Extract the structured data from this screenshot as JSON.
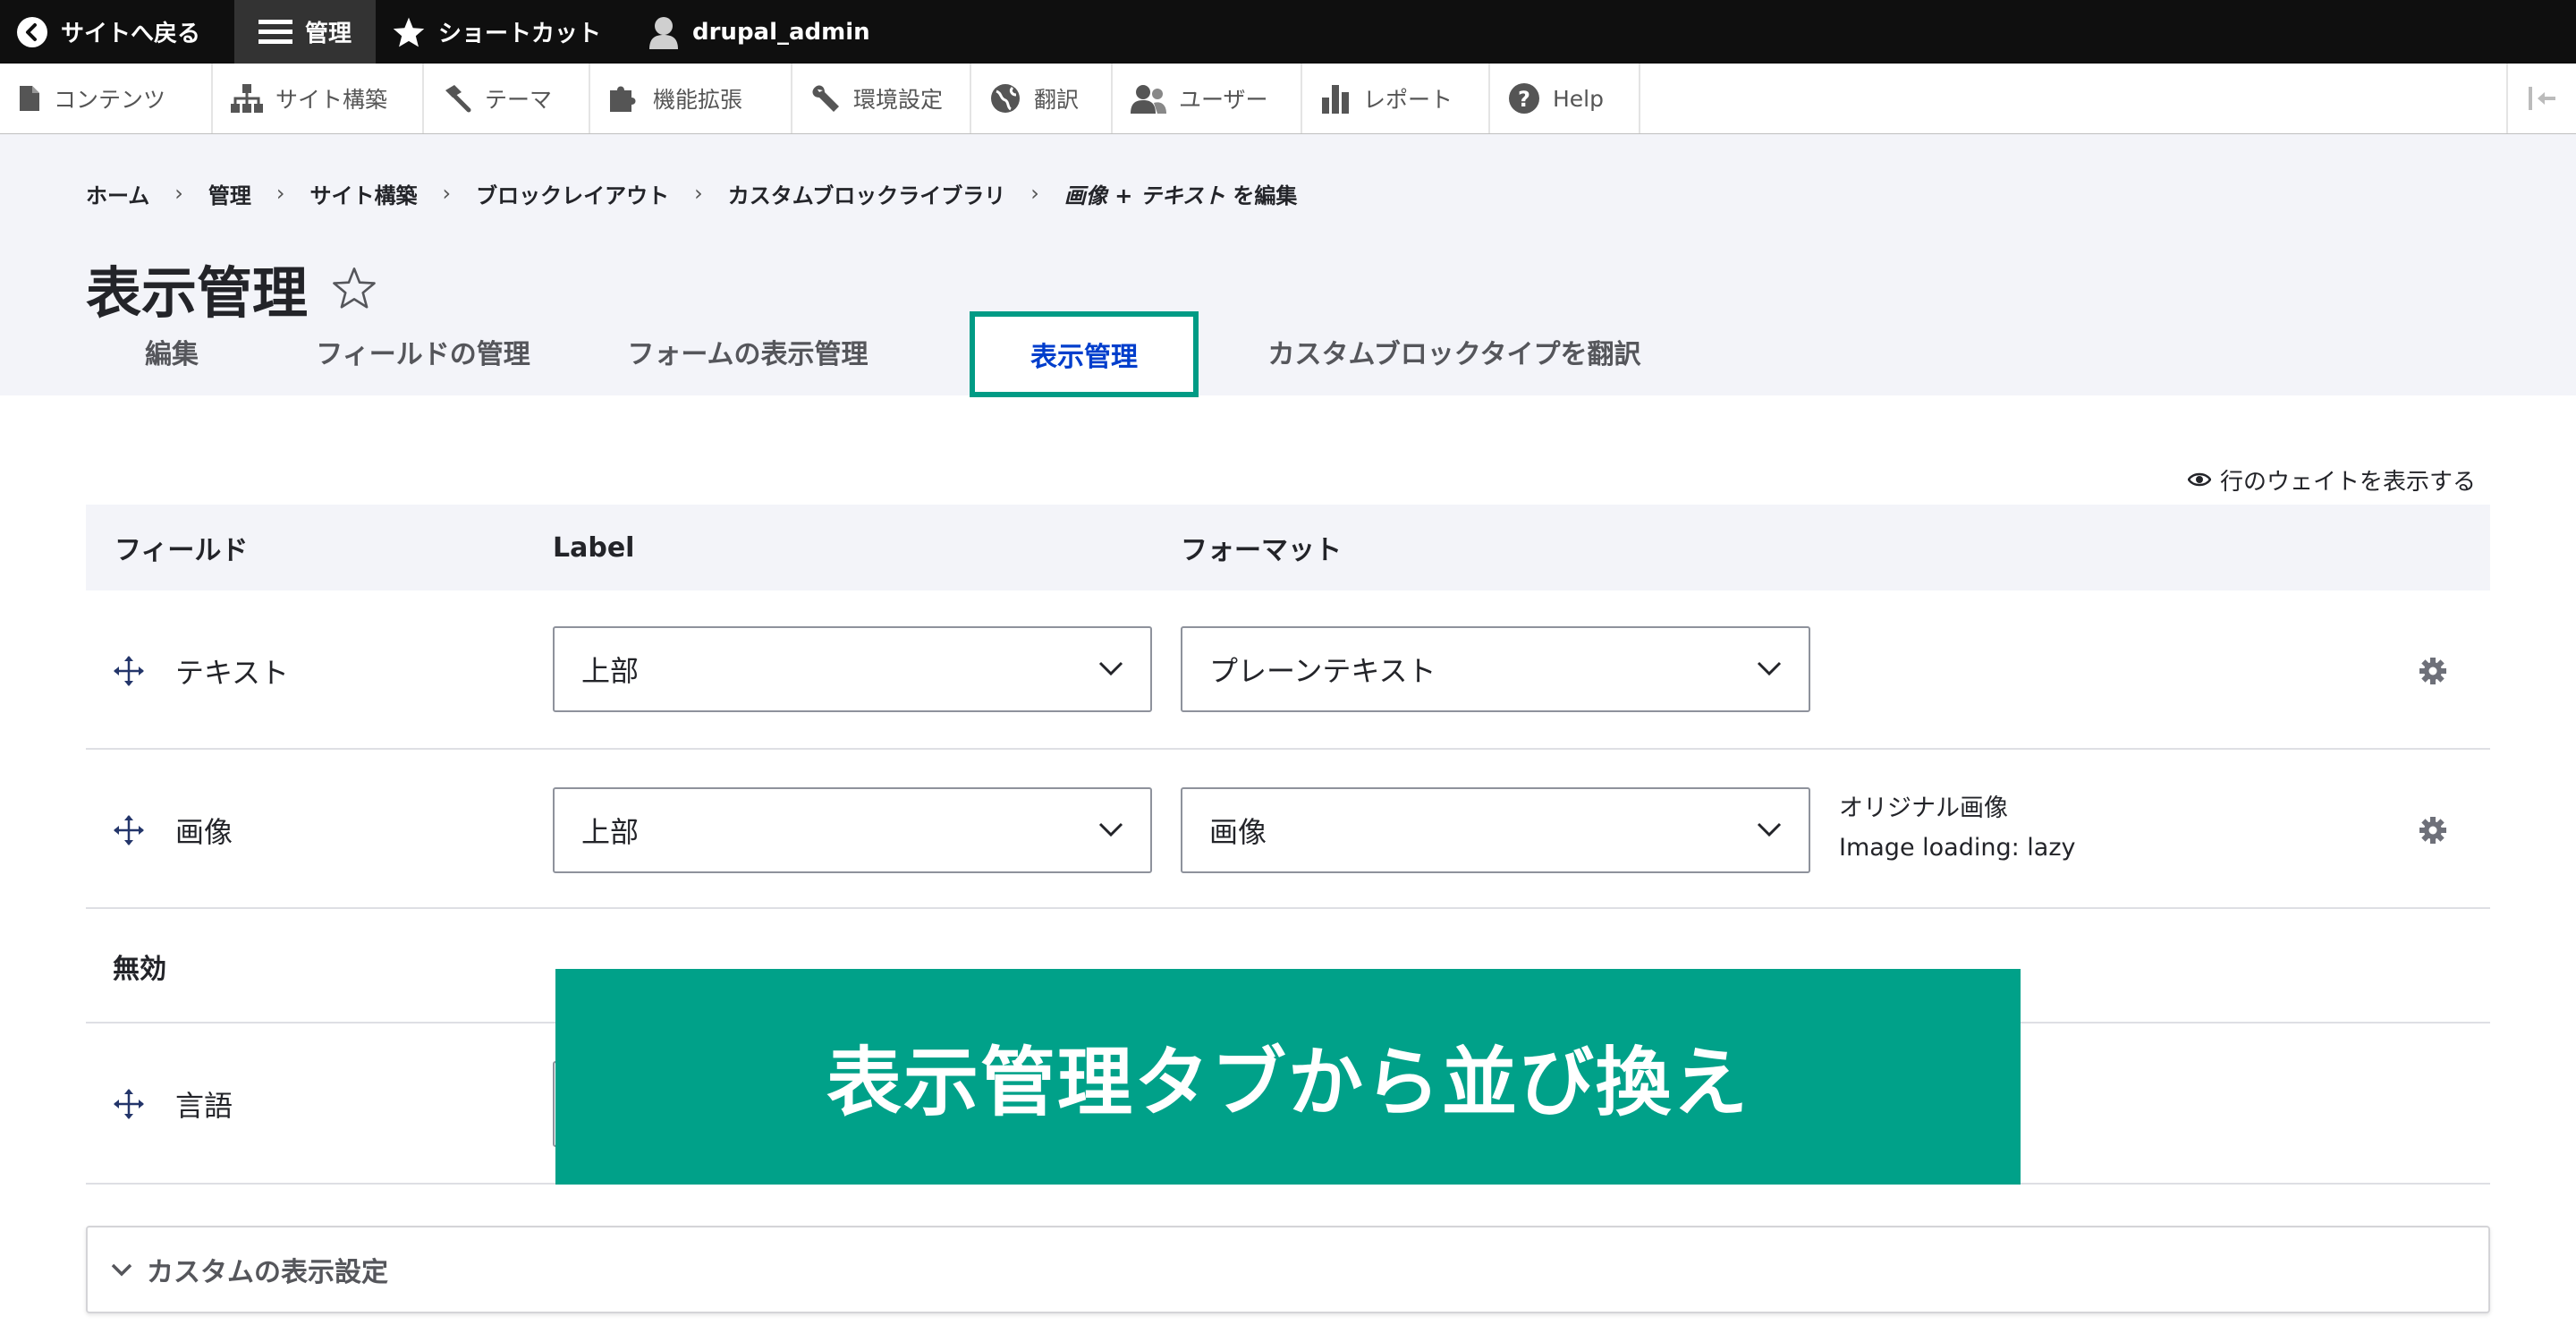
{
  "toolbar": {
    "back_label": "サイトへ戻る",
    "manage_label": "管理",
    "shortcuts_label": "ショートカット",
    "user_label": "drupal_admin"
  },
  "admin_menu": {
    "items": [
      {
        "label": "コンテンツ",
        "icon": "file-icon"
      },
      {
        "label": "サイト構築",
        "icon": "sitemap-icon"
      },
      {
        "label": "テーマ",
        "icon": "paintbrush-icon"
      },
      {
        "label": "機能拡張",
        "icon": "puzzle-icon"
      },
      {
        "label": "環境設定",
        "icon": "wrench-icon"
      },
      {
        "label": "翻訳",
        "icon": "globe-icon"
      },
      {
        "label": "ユーザー",
        "icon": "users-icon"
      },
      {
        "label": "レポート",
        "icon": "bar-chart-icon"
      },
      {
        "label": "Help",
        "icon": "help-icon"
      }
    ]
  },
  "breadcrumb": {
    "items": [
      "ホーム",
      "管理",
      "サイト構築",
      "ブロックレイアウト",
      "カスタムブロックライブラリ"
    ],
    "current_em": "画像 + テキスト",
    "current_suffix": " を編集",
    "separator": "›"
  },
  "page": {
    "title": "表示管理"
  },
  "tabs": [
    "編集",
    "フィールドの管理",
    "フォームの表示管理",
    "表示管理",
    "カスタムブロックタイプを翻訳"
  ],
  "weights_toggle": "行のウェイトを表示する",
  "table": {
    "headers": {
      "field": "フィールド",
      "label": "Label",
      "format": "フォーマット"
    },
    "rows": [
      {
        "name": "テキスト",
        "label_value": "上部",
        "format_value": "プレーンテキスト",
        "summary": [
          "",
          ""
        ]
      },
      {
        "name": "画像",
        "label_value": "上部",
        "format_value": "画像",
        "summary": [
          "オリジナル画像",
          "Image loading: lazy"
        ]
      }
    ],
    "disabled_region": "無効",
    "disabled_rows": [
      {
        "name": "言語"
      }
    ]
  },
  "custom_settings": {
    "label": "カスタムの表示設定"
  },
  "banner": {
    "text": "表示管理タブから並び換え"
  },
  "colors": {
    "accent": "#009b85",
    "active_tab_text": "#003ecc",
    "banner": "#00a189"
  }
}
